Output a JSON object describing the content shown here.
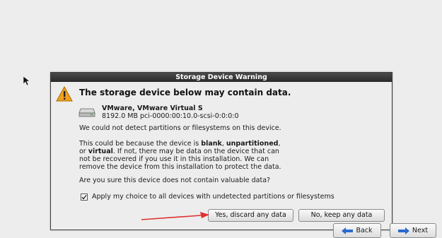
{
  "dialog": {
    "title": "Storage Device Warning",
    "headline": "The storage device below may contain data.",
    "device_name": "VMware, VMware Virtual S",
    "device_detail": "8192.0 MB   pci-0000:00:10.0-scsi-0:0:0:0",
    "para1": "We could not detect partitions or filesystems on this device.",
    "para2_a": "This could be because the device is ",
    "para2_blank": "blank",
    "para2_b": ", ",
    "para2_unpartitioned": "unpartitioned",
    "para2_c": ",",
    "para2_d": "or ",
    "para2_virtual": "virtual",
    "para2_e": ". If not, there may be data on the device that can",
    "para2_line3": "not be recovered if you use it in this installation. We can",
    "para2_line4": "remove the device from this installation to protect the data.",
    "para3": "Are you sure this device does not contain valuable data?",
    "checkbox_label": "Apply my choice to all devices with undetected partitions or filesystems",
    "checkbox_checked": true,
    "yes_label": "Yes, discard any data",
    "no_label": "No, keep any data"
  },
  "nav": {
    "back_label": "Back",
    "next_label": "Next"
  },
  "icons": {
    "warning": "warning-triangle-icon",
    "disk": "hard-disk-icon",
    "back": "arrow-left-icon",
    "next": "arrow-right-icon"
  },
  "colors": {
    "warning": "#f0a020",
    "arrow_blue": "#2a6ad0",
    "annotation_red": "#e03030"
  }
}
